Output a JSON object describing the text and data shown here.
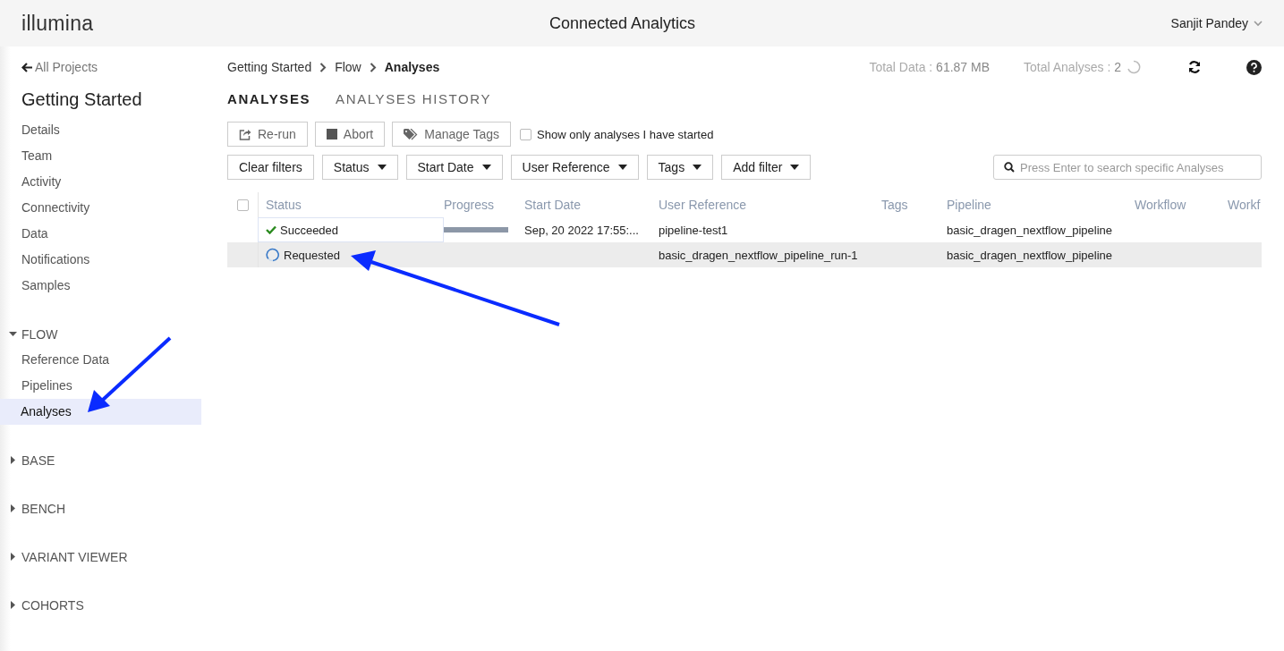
{
  "header": {
    "logo": "illumina",
    "title": "Connected Analytics",
    "user": "Sanjit Pandey"
  },
  "sidebar": {
    "back_link": "All Projects",
    "project_title": "Getting Started",
    "items": [
      {
        "label": "Details",
        "selected": false
      },
      {
        "label": "Team",
        "selected": false
      },
      {
        "label": "Activity",
        "selected": false
      },
      {
        "label": "Connectivity",
        "selected": false
      },
      {
        "label": "Data",
        "selected": false
      },
      {
        "label": "Notifications",
        "selected": false
      },
      {
        "label": "Samples",
        "selected": false
      }
    ],
    "sections": [
      {
        "label": "FLOW",
        "expanded": true,
        "children": [
          {
            "label": "Reference Data",
            "selected": false
          },
          {
            "label": "Pipelines",
            "selected": false
          },
          {
            "label": "Analyses",
            "selected": true
          }
        ]
      },
      {
        "label": "BASE",
        "expanded": false
      },
      {
        "label": "BENCH",
        "expanded": false
      },
      {
        "label": "VARIANT VIEWER",
        "expanded": false
      },
      {
        "label": "COHORTS",
        "expanded": false
      }
    ]
  },
  "breadcrumb": [
    "Getting Started",
    "Flow",
    "Analyses"
  ],
  "stats": [
    {
      "label": "Total Data :",
      "value": "61.87 MB"
    },
    {
      "label": "Total Analyses :",
      "value": "2",
      "loading": true
    }
  ],
  "tabs": [
    {
      "label": "ANALYSES",
      "selected": true
    },
    {
      "label": "ANALYSES HISTORY",
      "selected": false
    }
  ],
  "actions": [
    {
      "kind": "rerun",
      "label": "Re-run"
    },
    {
      "kind": "abort",
      "label": "Abort"
    },
    {
      "kind": "tags",
      "label": "Manage Tags"
    }
  ],
  "only_mine": {
    "label": "Show only analyses I have started",
    "checked": false
  },
  "filters": [
    {
      "kind": "plain",
      "label": "Clear filters"
    },
    {
      "kind": "dropdown",
      "label": "Status"
    },
    {
      "kind": "dropdown",
      "label": "Start Date"
    },
    {
      "kind": "dropdown",
      "label": "User Reference"
    },
    {
      "kind": "dropdown",
      "label": "Tags"
    },
    {
      "kind": "dropdown",
      "label": "Add filter"
    }
  ],
  "search": {
    "placeholder": "Press Enter to search specific Analyses"
  },
  "table": {
    "all_checked": false,
    "columns": [
      "Status",
      "Progress",
      "Start Date",
      "User Reference",
      "Tags",
      "Pipeline",
      "Workflow",
      "Workf"
    ],
    "rows": [
      {
        "kind": "succeeded",
        "status": "Succeeded",
        "level": 1,
        "start_date": "Sep, 20 2022 17:55:...",
        "user_reference": "pipeline-test1",
        "pipeline": "basic_dragen_nextflow_pipeline",
        "selected": false
      },
      {
        "kind": "requested",
        "status": "Requested",
        "user_reference": "basic_dragen_nextflow_pipeline_run-1",
        "pipeline": "basic_dragen_nextflow_pipeline",
        "selected": true
      }
    ]
  }
}
